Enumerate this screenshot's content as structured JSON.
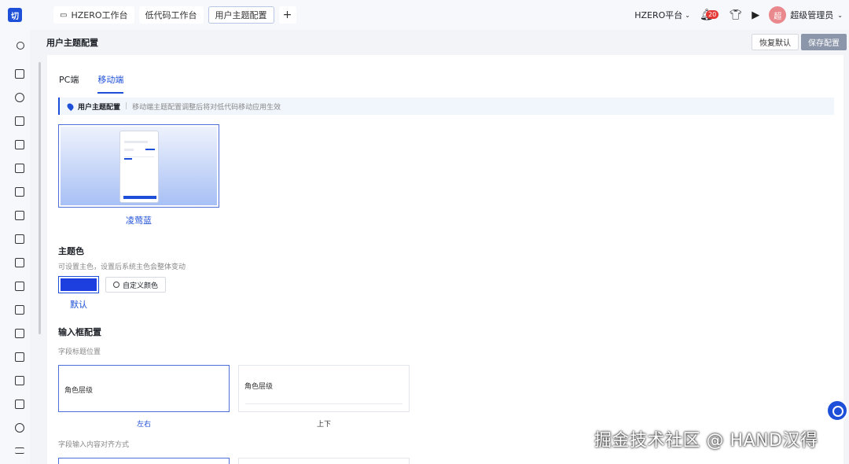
{
  "topbar": {
    "tabs": [
      {
        "label": "HZERO工作台"
      },
      {
        "label": "低代码工作台"
      },
      {
        "label": "用户主题配置"
      }
    ],
    "add_tab": "+",
    "platform": "HZERO平台",
    "notification_count": "20",
    "avatar_text": "超",
    "username": "超级管理员"
  },
  "header": {
    "title": "用户主题配置",
    "restore_label": "恢复默认",
    "save_label": "保存配置"
  },
  "mode_tabs": [
    {
      "label": "PC端",
      "active": false
    },
    {
      "label": "移动端",
      "active": true
    }
  ],
  "info": {
    "title": "用户主题配置",
    "desc": "移动端主题配置调整后将对低代码移动应用生效"
  },
  "theme_card": {
    "name": "凌莺蓝"
  },
  "theme_color": {
    "title": "主题色",
    "desc": "可设置主色，设置后系统主色会整体变动",
    "swatch_color": "#1d3fe0",
    "custom_label": "自定义颜色",
    "default_label": "默认"
  },
  "input_config": {
    "title": "输入框配置",
    "label_position_title": "字段标题位置",
    "options": [
      {
        "text": "角色层级",
        "caption": "左右",
        "selected": true
      },
      {
        "text": "角色层级",
        "caption": "上下",
        "selected": false
      }
    ],
    "align_title": "字段输入内容对齐方式"
  },
  "watermark": "掘金技术社区 @ HAND汉得"
}
